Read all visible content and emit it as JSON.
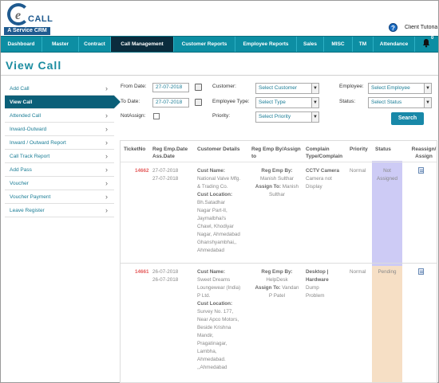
{
  "header": {
    "logo_word": "CALL",
    "logo_letter": "e",
    "logo_tagline": "A Service CRM",
    "help_glyph": "?",
    "client_name": "Client Tutoria",
    "notification_count": "0"
  },
  "nav": {
    "items": [
      {
        "label": "Dashboard"
      },
      {
        "label": "Master"
      },
      {
        "label": "Contract"
      },
      {
        "label": "Call Management",
        "active": true
      },
      {
        "label": "Customer Reports"
      },
      {
        "label": "Employee Reports"
      },
      {
        "label": "Sales"
      },
      {
        "label": "MISC"
      },
      {
        "label": "TM"
      },
      {
        "label": "Attendance"
      }
    ]
  },
  "page": {
    "title": "View Call"
  },
  "sidebar": {
    "items": [
      {
        "label": "Add Call"
      },
      {
        "label": "View Call",
        "active": true
      },
      {
        "label": "Attended Call"
      },
      {
        "label": "Inward-Outward"
      },
      {
        "label": "Inward / Outward Report"
      },
      {
        "label": "Call Track Report"
      },
      {
        "label": "Add Pass"
      },
      {
        "label": "Voucher"
      },
      {
        "label": "Voucher Payment"
      },
      {
        "label": "Leave Register"
      }
    ]
  },
  "filters": {
    "from_date_label": "From Date:",
    "from_date_value": "27-07-2018",
    "to_date_label": "To Date:",
    "to_date_value": "27-07-2018",
    "not_assign_label": "NotAssign:",
    "customer_label": "Customer:",
    "customer_value": "Select Customer",
    "employee_type_label": "Employee Type:",
    "employee_type_value": "Select Type",
    "priority_label": "Priority:",
    "priority_value": "Select Priority",
    "employee_label": "Employee:",
    "employee_value": "Select Employee",
    "status_label": "Status:",
    "status_value": "Select Status",
    "search_label": "Search"
  },
  "table": {
    "headers": {
      "ticket": "TicketNo",
      "reg_date": "Reg Emp.Date",
      "reg_date2": "Ass.Date",
      "customer": "Customer Details",
      "reg_emp": "Reg Emp By/Assign",
      "reg_emp2": "to",
      "complain": "Complain",
      "complain2": "Type/Complain",
      "priority": "Priority",
      "status": "Status",
      "reassign": "Reassign/",
      "reassign2": "Assign"
    },
    "rows": [
      {
        "ticket": "14662",
        "date1": "27-07-2018",
        "date2": "27-07-2018",
        "cust_name_label": "Cust Name:",
        "cust_name_lines": [
          "National Valve Mfg.",
          "& Trading Co."
        ],
        "cust_loc_label": "Cust Location:",
        "cust_loc_lines": [
          "Bh.Satadhar",
          "Nagar Part-II,",
          "Jaymalbhai's",
          "Chawl, Khodiyar",
          "Nagar, Ahmedabad",
          "Ghanshyambhai,,",
          "Ahmedabad"
        ],
        "reg_emp_label": "Reg Emp By:",
        "reg_emp_value": "Manish Sulthar",
        "assign_label": "Assign To:",
        "assign_value": "Manish",
        "assign_value2": "Sulthar",
        "complain_type": "CCTV Camera",
        "complain_lines": [
          "Camera not",
          "Display"
        ],
        "priority": "Normal",
        "status_lines": [
          "Not",
          "Assigned"
        ]
      },
      {
        "ticket": "14661",
        "date1": "26-07-2018",
        "date2": "26-07-2018",
        "cust_name_label": "Cust Name:",
        "cust_name_lines": [
          "Sweet Dreams",
          "Loungewear (India)",
          "P Ltd."
        ],
        "cust_loc_label": "Cust Location:",
        "cust_loc_lines": [
          "Survey No. 177,",
          "Near Apco Motors,",
          "Beside Krishna",
          "Mandir,",
          "Pragatinagar,",
          "Lambha,",
          "Ahmedabad.",
          ",,Ahmedabad"
        ],
        "reg_emp_label": "Reg Emp By:",
        "reg_emp_value": "HelpDesk",
        "assign_label": "Assign To:",
        "assign_value": "Vandan",
        "assign_value2": "P Patel",
        "complain_type": "Desktop |",
        "complain_type2": "Hardware",
        "complain_lines": [
          "Dump",
          "Problem"
        ],
        "priority": "Normal",
        "status_lines": [
          "Pending"
        ]
      }
    ]
  },
  "colors": {
    "nav": "#0d8ea3",
    "nav_active": "#0b2c3d",
    "accent": "#1b8ca0",
    "ticket": "#e45a5a"
  }
}
